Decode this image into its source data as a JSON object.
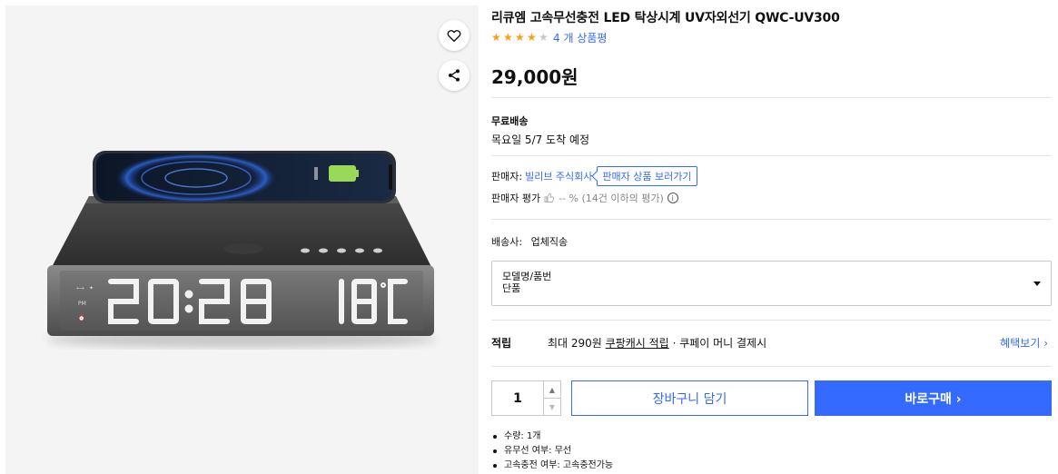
{
  "product": {
    "title": "리큐엠 고속무선충전 LED 탁상시계 UV자외선기 QWC-UV300",
    "rating": 4,
    "rating_max": 5,
    "review_count": "4 개 상품평",
    "price": "29,000원",
    "image": {
      "clock_digits": "20:28",
      "temperature": "18°C",
      "side_labels": [
        "PM"
      ]
    }
  },
  "shipping": {
    "title": "무료배송",
    "arrival": "목요일 5/7 도착 예정"
  },
  "seller": {
    "label": "판매자:",
    "name": "빌리브 주식회사",
    "more_button": "판매자 상품 보러가기",
    "eval_label": "판매자 평가",
    "eval_value": "-- % (14건 이하의 평가)",
    "info_icon": "ⓘ"
  },
  "courier": {
    "label": "배송사:",
    "value": "업체직송"
  },
  "option": {
    "label": "모델명/품번",
    "value": "단품"
  },
  "reward": {
    "title": "적립",
    "prefix": "최대 290원",
    "link_text": "쿠팡캐시 적립",
    "suffix": "· 쿠페이 머니 결제시",
    "more_link": "혜택보기 ›"
  },
  "purchase": {
    "quantity": "1",
    "cart_label": "장바구니 담기",
    "buy_label": "바로구매 ›"
  },
  "specs": [
    "수량: 1개",
    "유무선 여부: 무선",
    "고속충전 여부: 고속충전가능"
  ],
  "colors": {
    "accent": "#346aff",
    "star": "#f6a118",
    "led": "#f2f2f2",
    "device": "#5a5a5a"
  },
  "icons": {
    "wishlist": "heart-icon",
    "share": "share-icon"
  }
}
